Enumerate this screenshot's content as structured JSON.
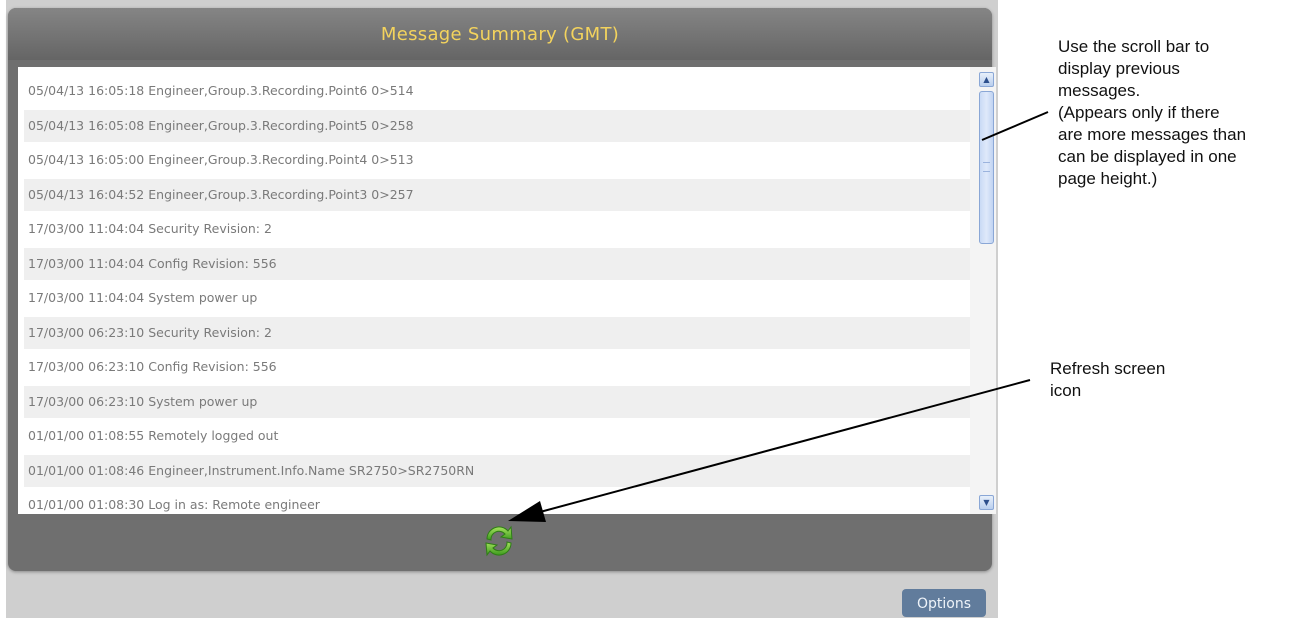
{
  "panel": {
    "title": "Message Summary (GMT)"
  },
  "messages": [
    {
      "timestamp": "05/04/13 16:05:18",
      "text": "Engineer,Group.3.Recording.Point6 0>514"
    },
    {
      "timestamp": "05/04/13 16:05:08",
      "text": "Engineer,Group.3.Recording.Point5 0>258"
    },
    {
      "timestamp": "05/04/13 16:05:00",
      "text": "Engineer,Group.3.Recording.Point4 0>513"
    },
    {
      "timestamp": "05/04/13 16:04:52",
      "text": "Engineer,Group.3.Recording.Point3 0>257"
    },
    {
      "timestamp": "17/03/00 11:04:04",
      "text": "Security Revision: 2"
    },
    {
      "timestamp": "17/03/00 11:04:04",
      "text": "Config Revision: 556"
    },
    {
      "timestamp": "17/03/00 11:04:04",
      "text": "System power up"
    },
    {
      "timestamp": "17/03/00 06:23:10",
      "text": "Security Revision: 2"
    },
    {
      "timestamp": "17/03/00 06:23:10",
      "text": "Config Revision: 556"
    },
    {
      "timestamp": "17/03/00 06:23:10",
      "text": "System power up"
    },
    {
      "timestamp": "01/01/00 01:08:55",
      "text": "Remotely logged out"
    },
    {
      "timestamp": "01/01/00 01:08:46",
      "text": "Engineer,Instrument.Info.Name SR2750>SR2750RN"
    },
    {
      "timestamp": "01/01/00 01:08:30",
      "text": "Log in as: Remote engineer"
    }
  ],
  "scrollbar": {
    "up_icon": "chevron-up-icon",
    "down_icon": "chevron-down-icon",
    "up_glyph": "▲",
    "down_glyph": "▼"
  },
  "refresh": {
    "icon": "refresh-icon",
    "colors": {
      "light": "#8fd34a",
      "dark": "#3c9a1e"
    }
  },
  "options_button": {
    "label": "Options"
  },
  "annotations": {
    "scrollbar_note": "Use the scroll bar to\ndisplay previous\nmessages.\n(Appears only if there\nare more messages than\ncan be displayed in one\npage height.)",
    "refresh_note": "Refresh screen\nicon"
  },
  "colors": {
    "title": "#f3d35d",
    "panel": "#6f6f6f",
    "row_alt": "#efefef",
    "options_button": "#617c9c"
  }
}
